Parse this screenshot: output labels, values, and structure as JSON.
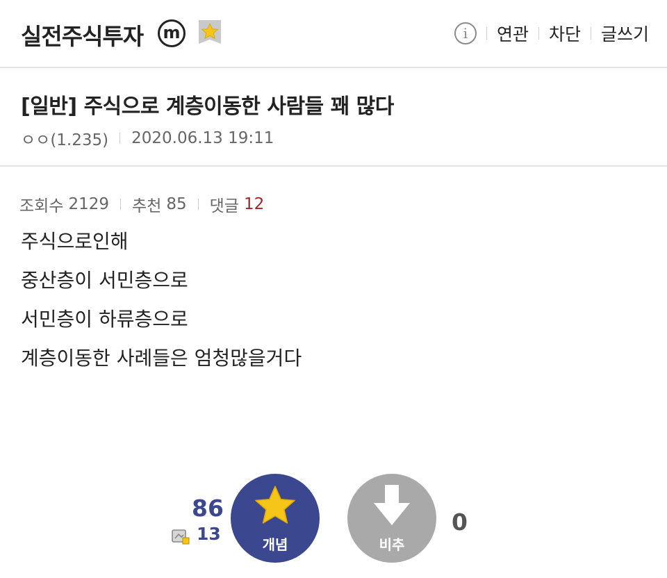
{
  "header": {
    "gallery_title": "실전주식투자",
    "minor_badge": "m",
    "fav_icon": "star-badge-icon",
    "info_icon": "info-icon",
    "links": [
      "연관",
      "차단",
      "글쓰기"
    ]
  },
  "post": {
    "title": "[일반] 주식으로 계층이동한 사람들 꽤 많다",
    "author": "ㅇㅇ(1.235)",
    "datetime": "2020.06.13 19:11",
    "views_label": "조회수",
    "views": "2129",
    "recommend_label": "추천",
    "recommend": "85",
    "comments_label": "댓글",
    "comments": "12",
    "body": [
      "주식으로인해",
      "중산층이 서민층으로",
      "서민층이 하류층으로",
      "계층이동한 사례들은 엄청많을거다"
    ]
  },
  "vote": {
    "up_count": "86",
    "fixed_count": "13",
    "up_label": "개념",
    "down_label": "비추",
    "down_count": "0"
  },
  "colors": {
    "vote_up": "#3b4890",
    "vote_down": "#a9a9a9",
    "star": "#f5c518",
    "comment_count": "#a3242a"
  }
}
